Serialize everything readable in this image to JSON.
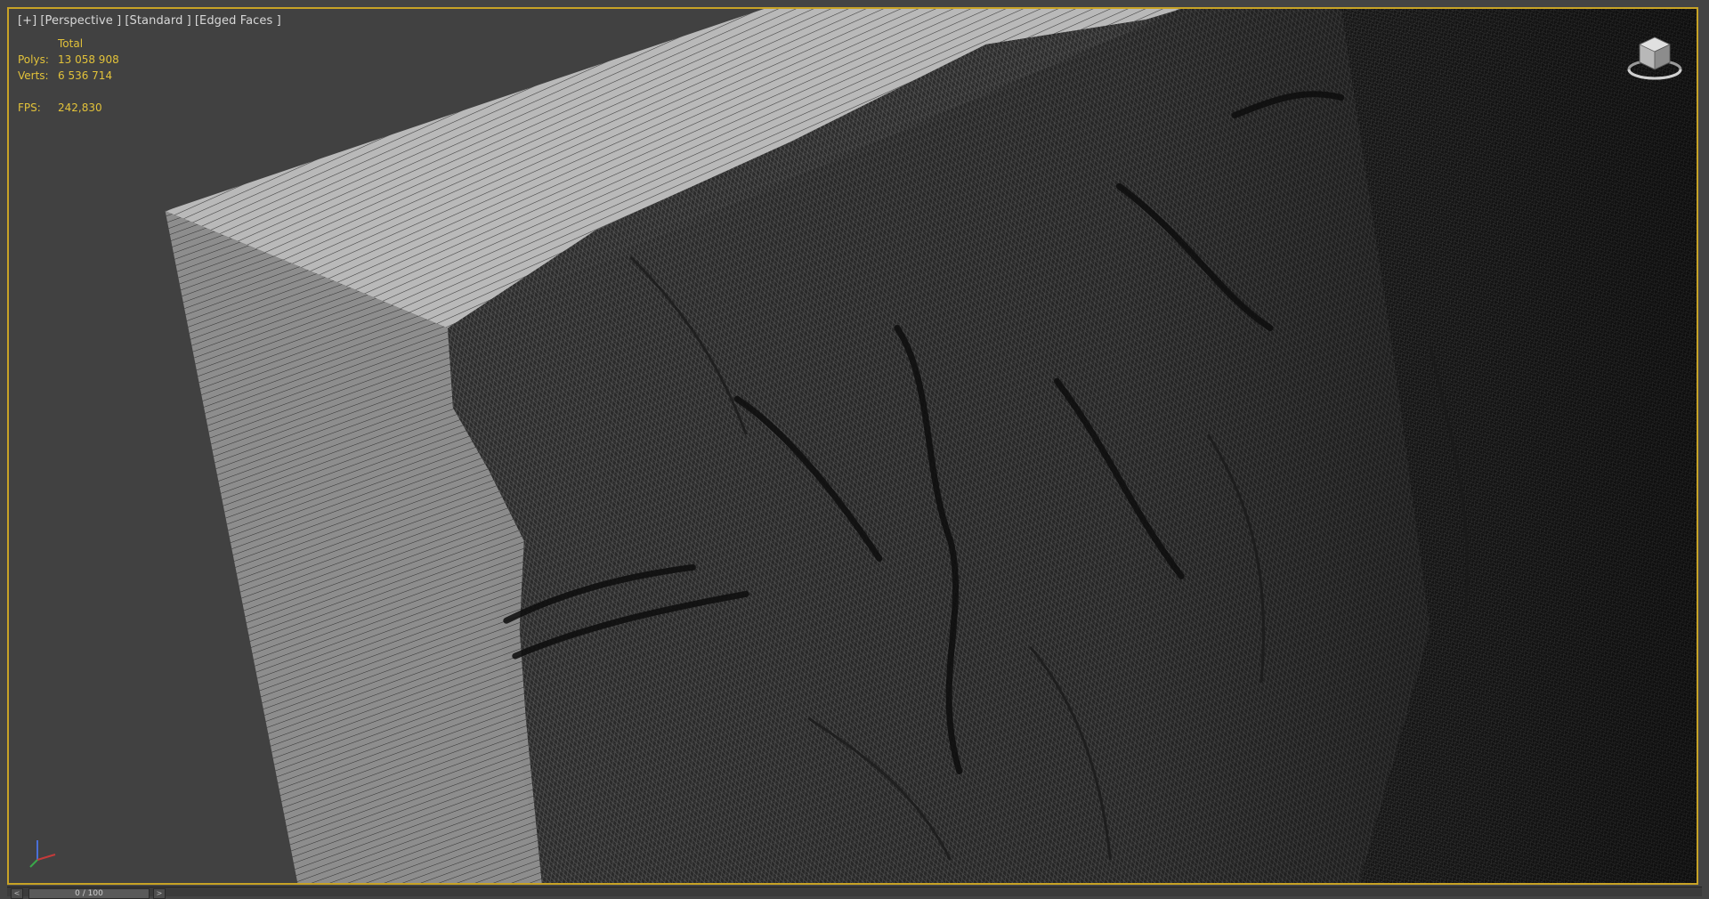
{
  "viewport": {
    "label_parts": [
      "[+]",
      "[Perspective ]",
      "[Standard ]",
      "[Edged Faces ]"
    ],
    "border_color": "#c8a326",
    "background_color": "#414141"
  },
  "stats": {
    "header": "Total",
    "polys_label": "Polys:",
    "polys_value": "13 058 908",
    "verts_label": "Verts:",
    "verts_value": "6 536 714",
    "fps_label": "FPS:",
    "fps_value": "242,830",
    "color": "#e2c23a"
  },
  "icons": {
    "viewcube": "viewcube-icon",
    "axis": "axis-tripod-icon"
  },
  "timebar": {
    "slider_label": "0 / 100",
    "prev_arrow": "<",
    "next_arrow": ">"
  }
}
